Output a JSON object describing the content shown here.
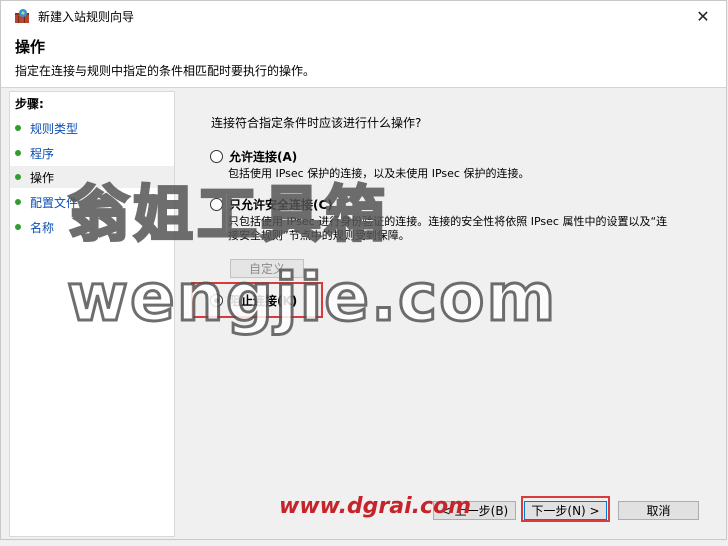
{
  "window": {
    "title": "新建入站规则向导",
    "close_glyph": "✕"
  },
  "header": {
    "title": "操作",
    "description": "指定在连接与规则中指定的条件相匹配时要执行的操作。"
  },
  "steps": {
    "title": "步骤:",
    "items": [
      {
        "label": "规则类型",
        "active": false
      },
      {
        "label": "程序",
        "active": false
      },
      {
        "label": "操作",
        "active": true
      },
      {
        "label": "配置文件",
        "active": false
      },
      {
        "label": "名称",
        "active": false
      }
    ]
  },
  "main": {
    "question": "连接符合指定条件时应该进行什么操作?",
    "options": [
      {
        "label": "允许连接(A)",
        "description": "包括使用 IPsec 保护的连接，以及未使用 IPsec 保护的连接。",
        "selected": false
      },
      {
        "label": "只允许安全连接(C)",
        "description": "只包括使用 IPsec 进行身份验证的连接。连接的安全性将依照 IPsec 属性中的设置以及“连接安全规则”节点中的规则受到保障。",
        "selected": false
      },
      {
        "label": "阻止连接(K)",
        "description": "",
        "selected": true
      }
    ],
    "customize_label": "自定义"
  },
  "buttons": {
    "prev": "< 上一步(B)",
    "next": "下一步(N) >",
    "cancel": "取消"
  },
  "watermarks": {
    "cn": "翁姐工具箱",
    "en": "wengjie.com",
    "url": "www.dgrai.com"
  },
  "colors": {
    "accent": "#0078d7",
    "highlight": "#d93a3a",
    "step_dot": "#2f9e2f"
  }
}
